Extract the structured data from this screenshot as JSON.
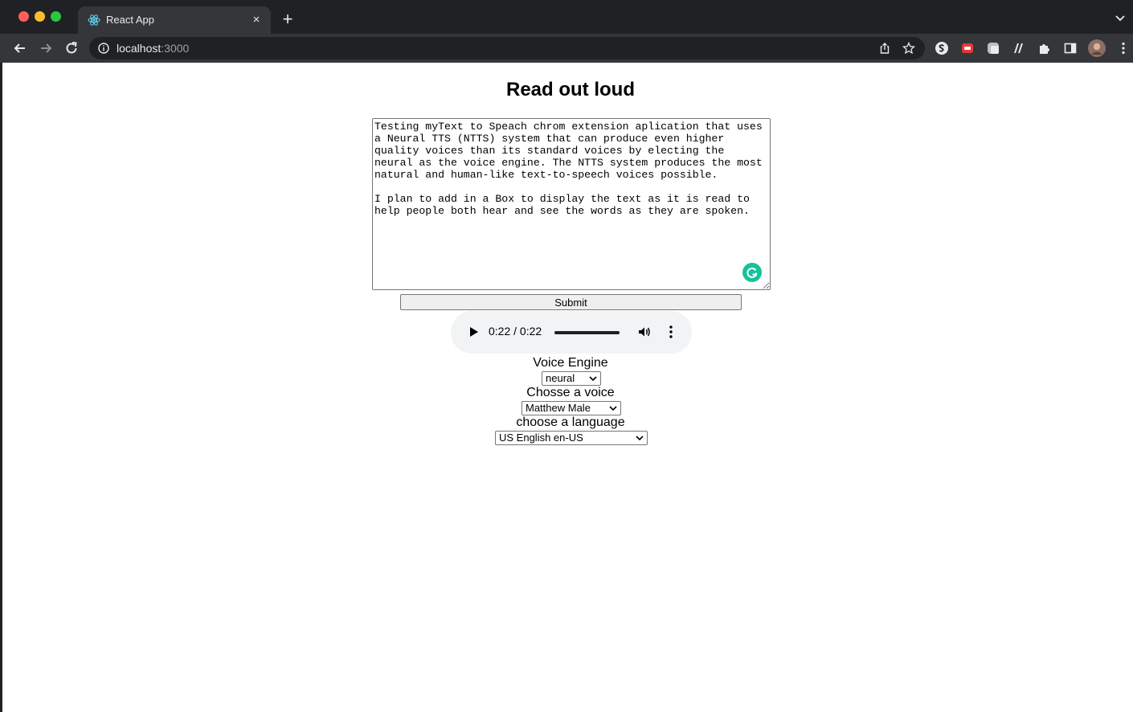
{
  "browser": {
    "tab_title": "React App",
    "tab_close": "×",
    "new_tab": "+",
    "url_host": "localhost",
    "url_port": ":3000"
  },
  "page": {
    "title": "Read out loud",
    "textarea_value": "Testing myText to Speach chrom extension aplication that uses\na Neural TTS (NTTS) system that can produce even higher\nquality voices than its standard voices by electing the\nneural as the voice engine. The NTTS system produces the most\nnatural and human-like text-to-speech voices possible.\n\nI plan to add in a Box to display the text as it is read to\nhelp people both hear and see the words as they are spoken.",
    "submit_label": "Submit",
    "audio": {
      "time": "0:22 / 0:22",
      "progress": 1.0
    },
    "voice_engine": {
      "label": "Voice Engine",
      "value": "neural"
    },
    "voice": {
      "label": "Chosse a voice",
      "value": "Matthew Male"
    },
    "language": {
      "label": "choose a language",
      "value": "US English en-US"
    }
  },
  "colors": {
    "grammarly": "#15c39a",
    "chrome_dark": "#202124",
    "toolbar": "#35363a"
  }
}
